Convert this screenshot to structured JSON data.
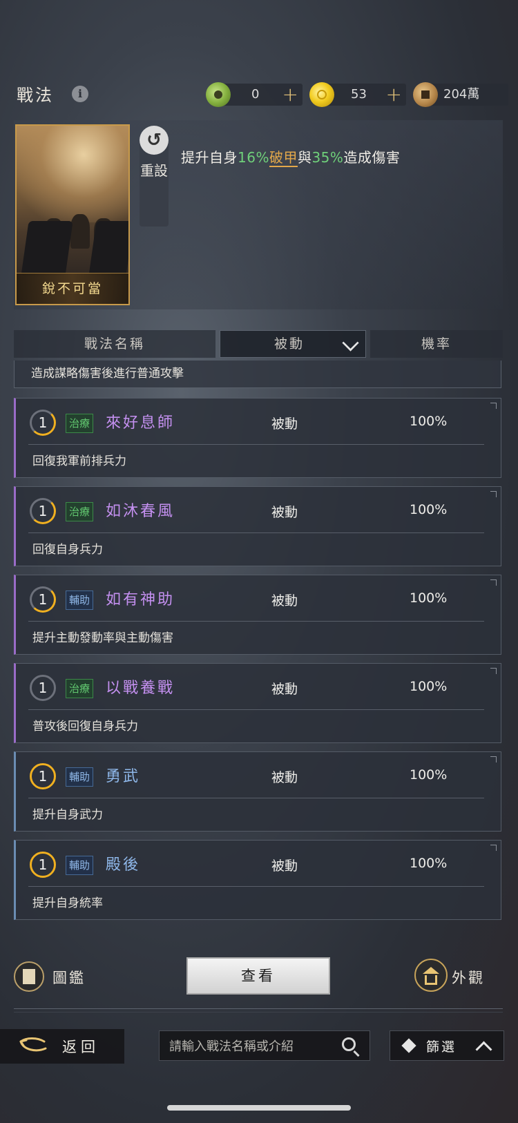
{
  "header": {
    "title": "戰法",
    "info_icon": "info-icon",
    "resources": [
      {
        "icon": "jade-coin-icon",
        "value": "0",
        "has_plus": true
      },
      {
        "icon": "gold-coin-icon",
        "value": "53",
        "has_plus": true
      },
      {
        "icon": "copper-coin-icon",
        "value": "204萬",
        "has_plus": false
      }
    ]
  },
  "detail": {
    "card_name": "銳不可當",
    "reset_label": "重設",
    "desc_parts": {
      "p1": "提升自身",
      "pct1": "16%",
      "kw": "破甲",
      "p2": "與",
      "pct2": "35%",
      "p3": "造成傷害"
    }
  },
  "columns": {
    "name": "戰法名稱",
    "type_filter": "被動",
    "rate": "機率"
  },
  "partial_item_desc": "造成謀略傷害後進行普通攻擊",
  "items": [
    {
      "level": "1",
      "tag": "治療",
      "name": "來好息師",
      "type": "被動",
      "rate": "100%",
      "desc": "回復我軍前排兵力"
    },
    {
      "level": "1",
      "tag": "治療",
      "name": "如沐春風",
      "type": "被動",
      "rate": "100%",
      "desc": "回復自身兵力"
    },
    {
      "level": "1",
      "tag": "輔助",
      "name": "如有神助",
      "type": "被動",
      "rate": "100%",
      "desc": "提升主動發動率與主動傷害"
    },
    {
      "level": "1",
      "tag": "治療",
      "name": "以戰養戰",
      "type": "被動",
      "rate": "100%",
      "desc": "普攻後回復自身兵力"
    },
    {
      "level": "1",
      "tag": "輔助",
      "name": "勇武",
      "type": "被動",
      "rate": "100%",
      "desc": "提升自身武力"
    },
    {
      "level": "1",
      "tag": "輔助",
      "name": "殿後",
      "type": "被動",
      "rate": "100%",
      "desc": "提升自身統率"
    }
  ],
  "actions": {
    "catalog_label": "圖鑑",
    "view_label": "查看",
    "appearance_label": "外觀"
  },
  "footer": {
    "back_label": "返回",
    "search_placeholder": "請輸入戰法名稱或介紹",
    "filter_label": "篩選"
  },
  "colors": {
    "accent_gold": "#f0b020",
    "heal_green": "#62c870",
    "aux_blue": "#8eb6e6",
    "name_purple": "#c490f0",
    "name_blue": "#8fb8ea"
  }
}
